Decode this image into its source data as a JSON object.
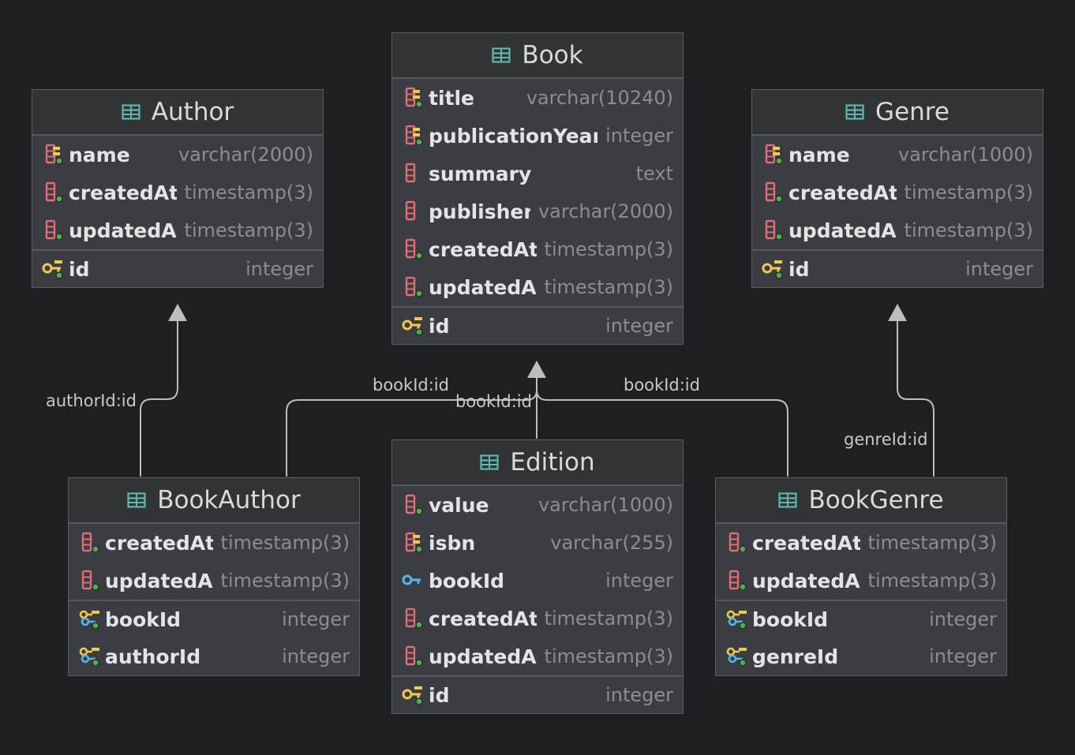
{
  "tables": {
    "book": {
      "title": "Book",
      "columns": [
        {
          "name": "title",
          "type": "varchar(10240)",
          "icon": "indexed-column-icon"
        },
        {
          "name": "publicationYear",
          "type": "integer",
          "icon": "indexed-column-icon"
        },
        {
          "name": "summary",
          "type": "text",
          "icon": "nullable-column-icon"
        },
        {
          "name": "publisher",
          "type": "varchar(2000)",
          "icon": "nullable-column-icon"
        },
        {
          "name": "createdAt",
          "type": "timestamp(3)",
          "icon": "column-icon"
        },
        {
          "name": "updatedAt",
          "type": "timestamp(3)",
          "icon": "column-icon"
        }
      ],
      "keys": [
        {
          "name": "id",
          "type": "integer",
          "icon": "primary-key-icon"
        }
      ]
    },
    "author": {
      "title": "Author",
      "columns": [
        {
          "name": "name",
          "type": "varchar(2000)",
          "icon": "indexed-column-icon"
        },
        {
          "name": "createdAt",
          "type": "timestamp(3)",
          "icon": "column-icon"
        },
        {
          "name": "updatedAt",
          "type": "timestamp(3)",
          "icon": "column-icon"
        }
      ],
      "keys": [
        {
          "name": "id",
          "type": "integer",
          "icon": "primary-key-icon"
        }
      ]
    },
    "genre": {
      "title": "Genre",
      "columns": [
        {
          "name": "name",
          "type": "varchar(1000)",
          "icon": "indexed-column-icon"
        },
        {
          "name": "createdAt",
          "type": "timestamp(3)",
          "icon": "column-icon"
        },
        {
          "name": "updatedAt",
          "type": "timestamp(3)",
          "icon": "column-icon"
        }
      ],
      "keys": [
        {
          "name": "id",
          "type": "integer",
          "icon": "primary-key-icon"
        }
      ]
    },
    "bookauthor": {
      "title": "BookAuthor",
      "columns": [
        {
          "name": "createdAt",
          "type": "timestamp(3)",
          "icon": "column-icon"
        },
        {
          "name": "updatedAt",
          "type": "timestamp(3)",
          "icon": "column-icon"
        }
      ],
      "keys": [
        {
          "name": "bookId",
          "type": "integer",
          "icon": "composite-key-icon"
        },
        {
          "name": "authorId",
          "type": "integer",
          "icon": "composite-key-icon"
        }
      ]
    },
    "edition": {
      "title": "Edition",
      "columns": [
        {
          "name": "value",
          "type": "varchar(1000)",
          "icon": "column-icon"
        },
        {
          "name": "isbn",
          "type": "varchar(255)",
          "icon": "indexed-column-icon"
        },
        {
          "name": "bookId",
          "type": "integer",
          "icon": "foreign-key-icon"
        },
        {
          "name": "createdAt",
          "type": "timestamp(3)",
          "icon": "column-icon"
        },
        {
          "name": "updatedAt",
          "type": "timestamp(3)",
          "icon": "column-icon"
        }
      ],
      "keys": [
        {
          "name": "id",
          "type": "integer",
          "icon": "primary-key-icon"
        }
      ]
    },
    "bookgenre": {
      "title": "BookGenre",
      "columns": [
        {
          "name": "createdAt",
          "type": "timestamp(3)",
          "icon": "column-icon"
        },
        {
          "name": "updatedAt",
          "type": "timestamp(3)",
          "icon": "column-icon"
        }
      ],
      "keys": [
        {
          "name": "bookId",
          "type": "integer",
          "icon": "composite-key-icon"
        },
        {
          "name": "genreId",
          "type": "integer",
          "icon": "composite-key-icon"
        }
      ]
    }
  },
  "relations": {
    "bookauthor_author": "authorId:id",
    "bookauthor_book": "bookId:id",
    "edition_book": "bookId:id",
    "bookgenre_book": "bookId:id",
    "bookgenre_genre": "genreId:id"
  },
  "colors": {
    "background": "#1e1f22",
    "header_icon": "#5fb8b0",
    "column_icon": "#e06c75",
    "key_gold": "#f2c94c",
    "key_blue": "#56b6e8",
    "nullable_dot": "#4caf50",
    "connector": "#bdbdbd"
  }
}
